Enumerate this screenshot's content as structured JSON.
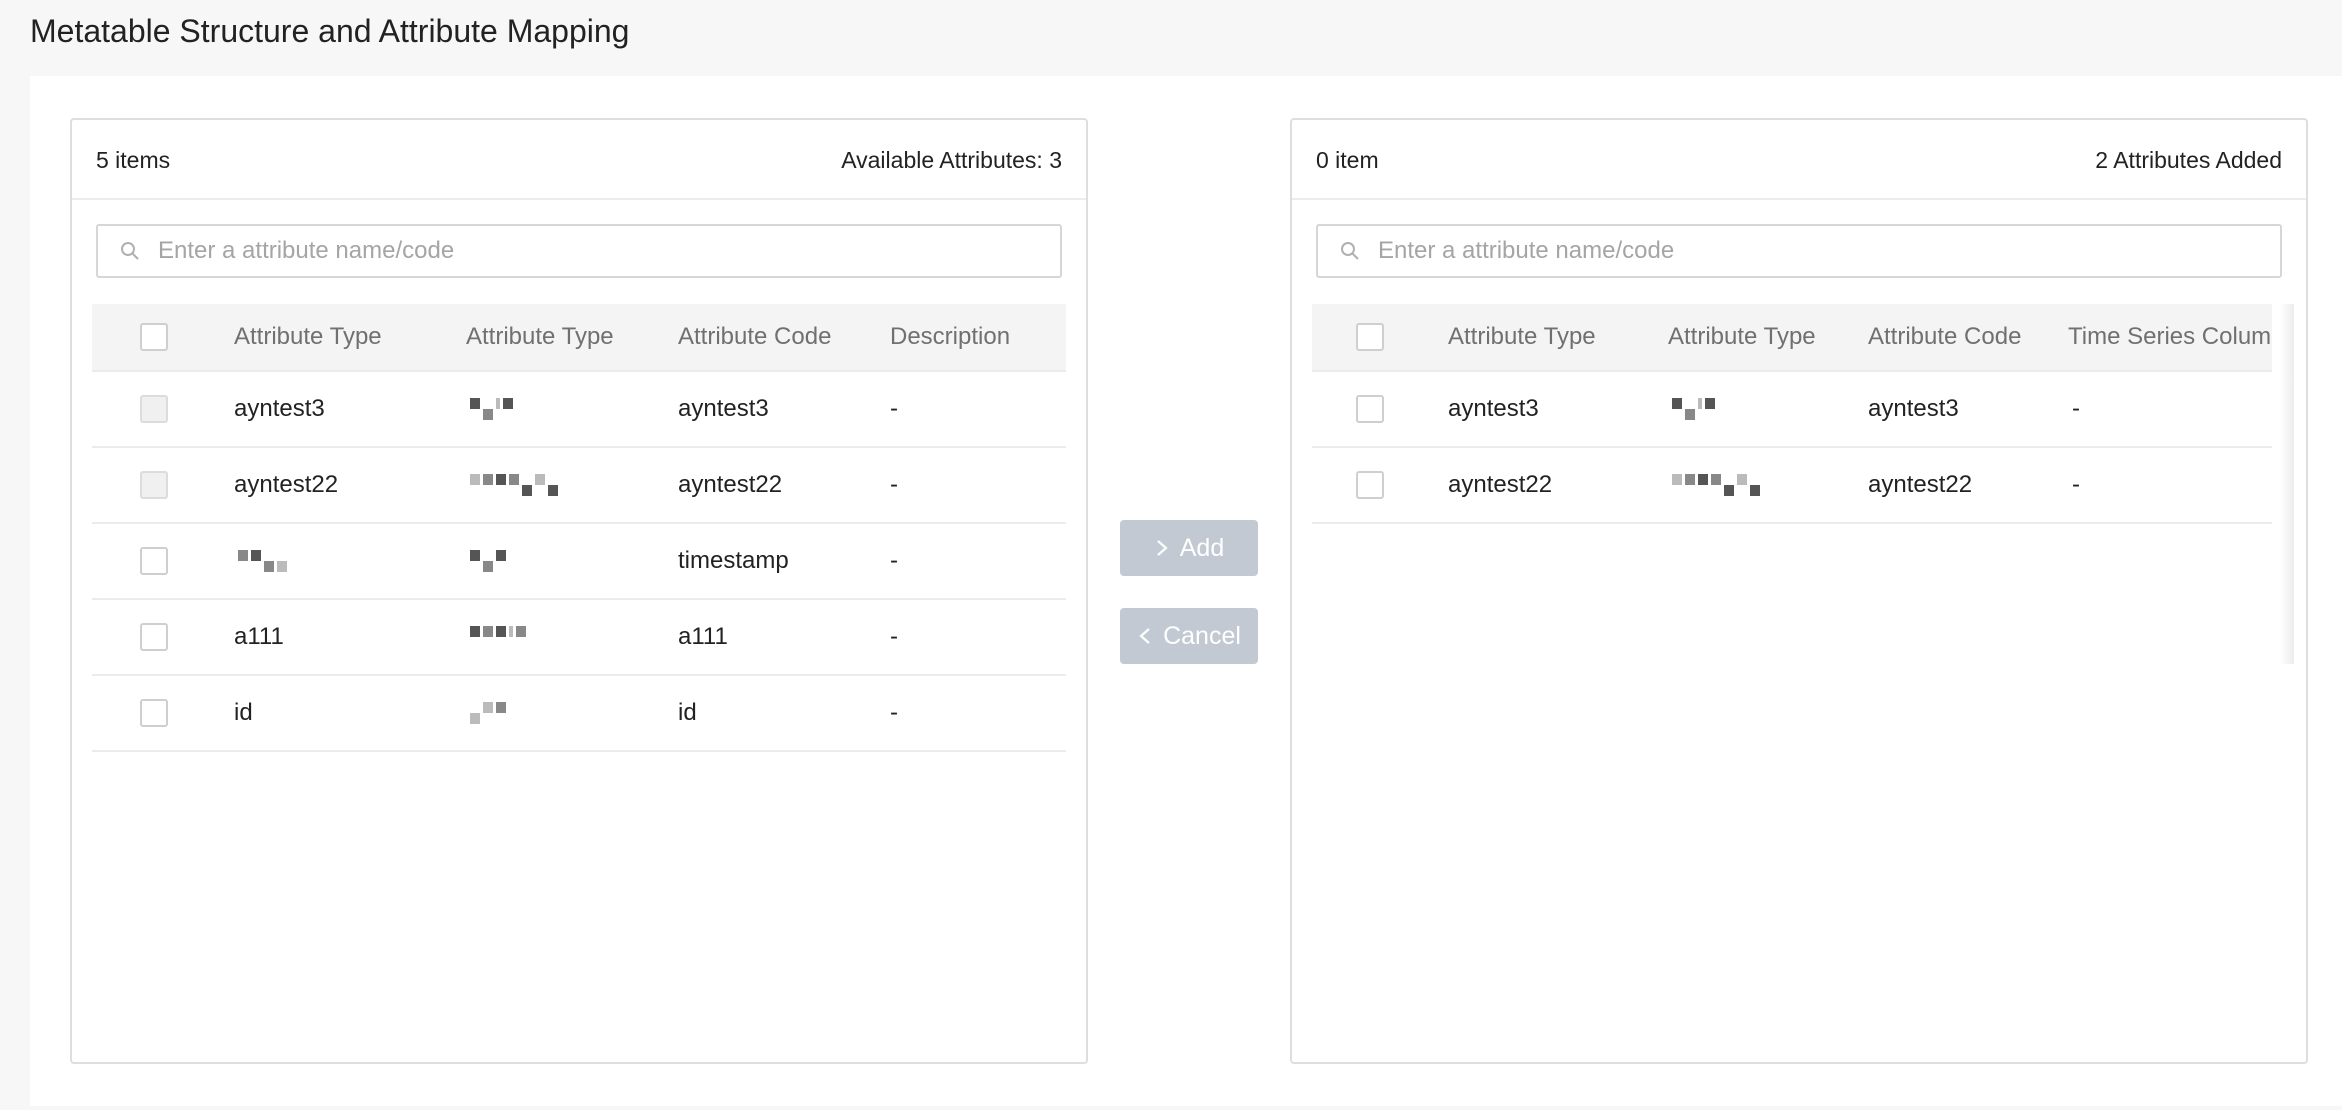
{
  "page": {
    "title": "Metatable Structure and Attribute Mapping"
  },
  "left_panel": {
    "count": "5 items",
    "summary": "Available Attributes: 3",
    "search_placeholder": "Enter a attribute name/code",
    "columns": [
      "Attribute Type",
      "Attribute Type",
      "Attribute Code",
      "Description"
    ],
    "rows": [
      {
        "type": "ayntest3",
        "code": "ayntest3",
        "description": "-",
        "disabled": true
      },
      {
        "type": "ayntest22",
        "code": "ayntest22",
        "description": "-",
        "disabled": true
      },
      {
        "type": "",
        "code": "timestamp",
        "description": "-",
        "disabled": false
      },
      {
        "type": "a111",
        "code": "a111",
        "description": "-",
        "disabled": false
      },
      {
        "type": "id",
        "code": "id",
        "description": "-",
        "disabled": false
      }
    ]
  },
  "right_panel": {
    "count": "0 item",
    "summary": "2 Attributes Added",
    "search_placeholder": "Enter a attribute name/code",
    "columns": [
      "Attribute Type",
      "Attribute Type",
      "Attribute Code",
      "Time Series Column"
    ],
    "rows": [
      {
        "type": "ayntest3",
        "code": "ayntest3",
        "time_series": "-"
      },
      {
        "type": "ayntest22",
        "code": "ayntest22",
        "time_series": "-"
      }
    ]
  },
  "actions": {
    "add_label": "Add",
    "cancel_label": "Cancel"
  },
  "icons": {
    "search": "search-icon",
    "add": "chevron-right-icon",
    "cancel": "chevron-left-icon"
  },
  "colors": {
    "button_disabled_bg": "#c3c9d3",
    "header_bg": "#f4f4f4",
    "border": "#dedede"
  }
}
